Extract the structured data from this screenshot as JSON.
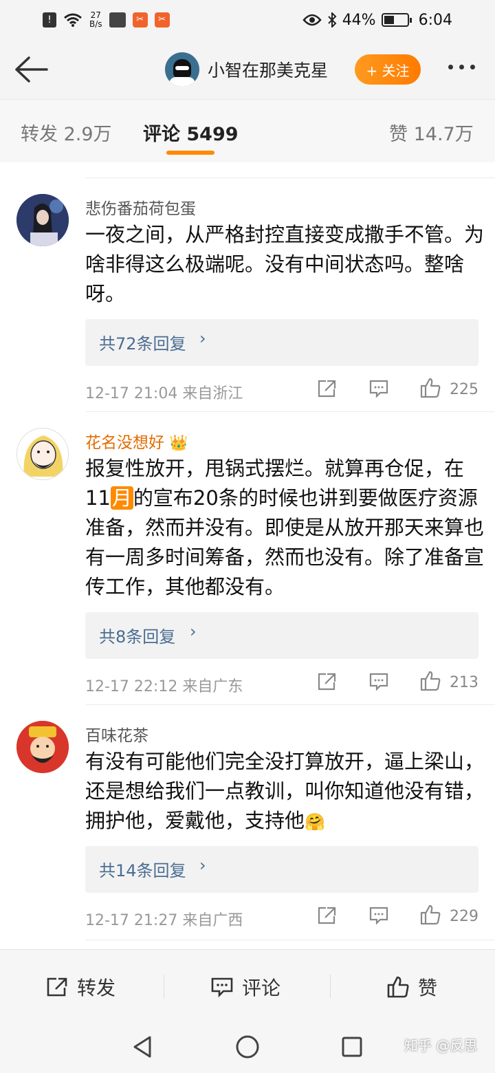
{
  "status_bar": {
    "network_speed_value": "27",
    "network_speed_unit": "B/s",
    "battery": "44%",
    "battery_level": 0.44,
    "time": "6:04"
  },
  "header": {
    "username": "小智在那美克星",
    "follow_label": "+ 关注"
  },
  "tabs": [
    {
      "label": "转发 2.9万",
      "active": false
    },
    {
      "label": "评论 5499",
      "active": true
    },
    {
      "label": "赞 14.7万",
      "active": false
    }
  ],
  "comments": [
    {
      "name": "悲伤番茄荷包蛋",
      "text": "一夜之间，从严格封控直接变成撒手不管。为啥非得这么极端呢。没有中间状态吗。整啥呀。",
      "replies": "共72条回复",
      "date": "12-17 21:04",
      "location": "来自浙江",
      "likes": "225"
    },
    {
      "name": "花名没想好",
      "text_before": "报复性放开，甩锅式摆烂。就算再仓促，在11",
      "text_badge": "月",
      "text_after": "的宣布20条的时候也讲到要做医疗资源准备，然而并没有。即使是从放开那天来算也有一周多时间筹备，然而也没有。除了准备宣传工作，其他都没有。",
      "replies": "共8条回复",
      "date": "12-17 22:12",
      "location": "来自广东",
      "likes": "213"
    },
    {
      "name": "百味花茶",
      "text": "有没有可能他们完全没打算放开，逼上梁山，还是想给我们一点教训，叫你知道他没有错，拥护他，爱戴他，支持他",
      "replies": "共14条回复",
      "date": "12-17 21:27",
      "location": "来自广西",
      "likes": "229"
    }
  ],
  "bottom_bar": {
    "repost": "转发",
    "comment": "评论",
    "like": "赞"
  },
  "watermark": "知乎 @反思"
}
